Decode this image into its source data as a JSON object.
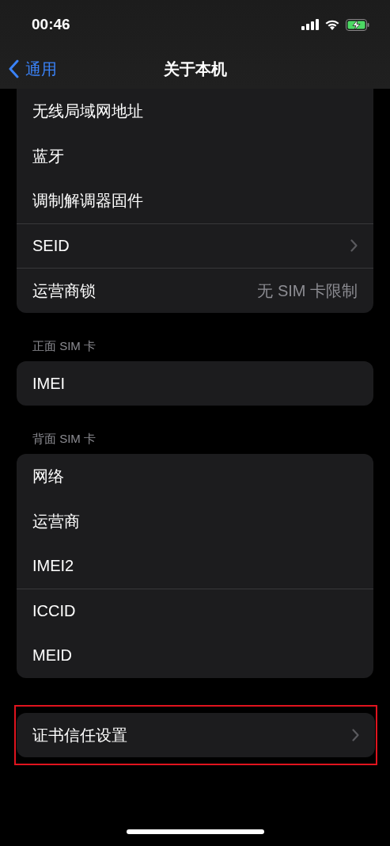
{
  "status_bar": {
    "time": "00:46"
  },
  "nav": {
    "back": "通用",
    "title": "关于本机"
  },
  "groups": [
    {
      "top_cut": true,
      "highlighted": false,
      "rows": [
        {
          "label": "无线局域网地址",
          "divider_above": false,
          "chevron": false
        },
        {
          "label": "蓝牙",
          "divider_above": false,
          "chevron": false
        },
        {
          "label": "调制解调器固件",
          "divider_above": false,
          "chevron": false
        },
        {
          "label": "SEID",
          "divider_above": true,
          "chevron": true
        },
        {
          "label": "运营商锁",
          "value": "无 SIM 卡限制",
          "divider_above": true,
          "chevron": false
        }
      ]
    },
    {
      "header": "正面 SIM 卡",
      "top_cut": false,
      "highlighted": false,
      "rows": [
        {
          "label": "IMEI",
          "divider_above": false,
          "chevron": false
        }
      ]
    },
    {
      "header": "背面 SIM 卡",
      "top_cut": false,
      "highlighted": false,
      "rows": [
        {
          "label": "网络",
          "divider_above": false,
          "chevron": false
        },
        {
          "label": "运营商",
          "divider_above": false,
          "chevron": false
        },
        {
          "label": "IMEI2",
          "divider_above": false,
          "chevron": false
        },
        {
          "label": "ICCID",
          "divider_above": true,
          "chevron": false
        },
        {
          "label": "MEID",
          "divider_above": false,
          "chevron": false
        }
      ]
    },
    {
      "top_cut": false,
      "highlighted": true,
      "rows": [
        {
          "label": "证书信任设置",
          "divider_above": false,
          "chevron": true
        }
      ]
    }
  ]
}
